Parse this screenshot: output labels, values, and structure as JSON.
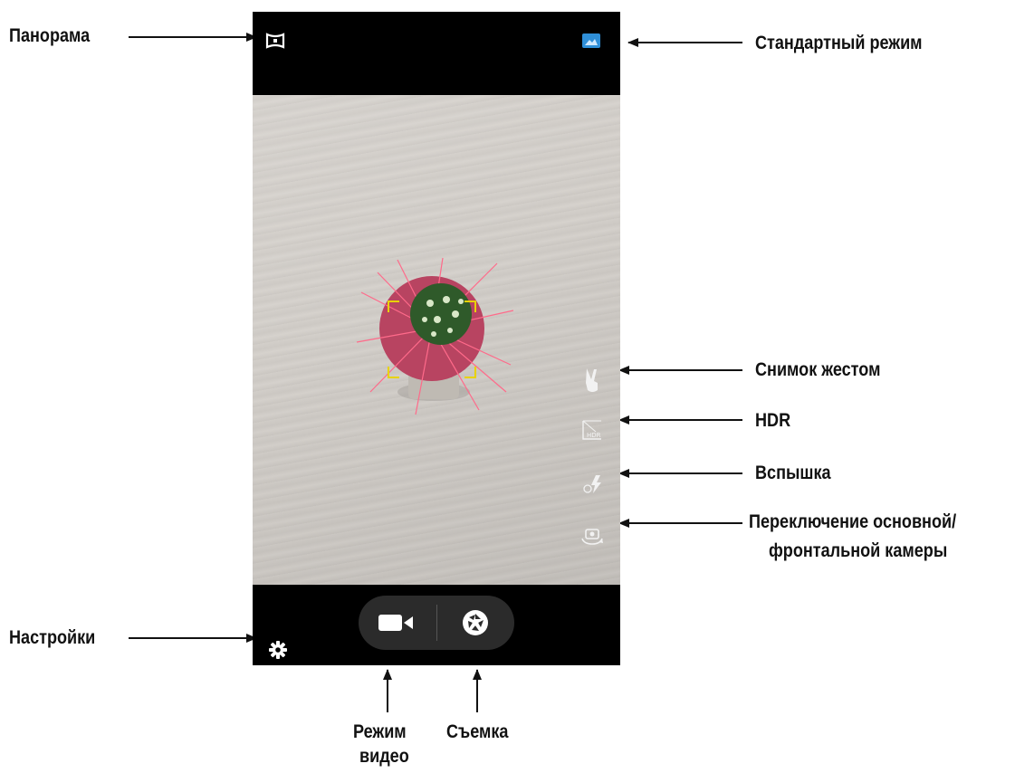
{
  "labels": {
    "panorama": "Панорама",
    "standard_mode": "Стандартный режим",
    "gesture_shot": "Снимок жестом",
    "hdr": "HDR",
    "flash": "Вспышка",
    "switch_camera_line1": "Переключение основной/",
    "switch_camera_line2": "фронтальной камеры",
    "settings": "Настройки",
    "video_mode_line1": "Режим",
    "video_mode_line2": "видео",
    "shoot": "Съемка"
  },
  "icons": {
    "panorama": "panorama-icon",
    "standard_mode": "image-mode-icon",
    "gesture_shot": "hand-gesture-icon",
    "hdr": "hdr-icon",
    "hdr_text": "HDR",
    "flash": "flash-auto-icon",
    "switch_camera": "camera-switch-icon",
    "settings": "gear-icon",
    "video": "video-camera-icon",
    "shutter": "shutter-icon"
  },
  "colors": {
    "accent": "#2f8fd8",
    "cactus_spines": "#ff5a7a",
    "cactus_body": "#2f5a2a",
    "focus_frame": "#e8d200"
  }
}
